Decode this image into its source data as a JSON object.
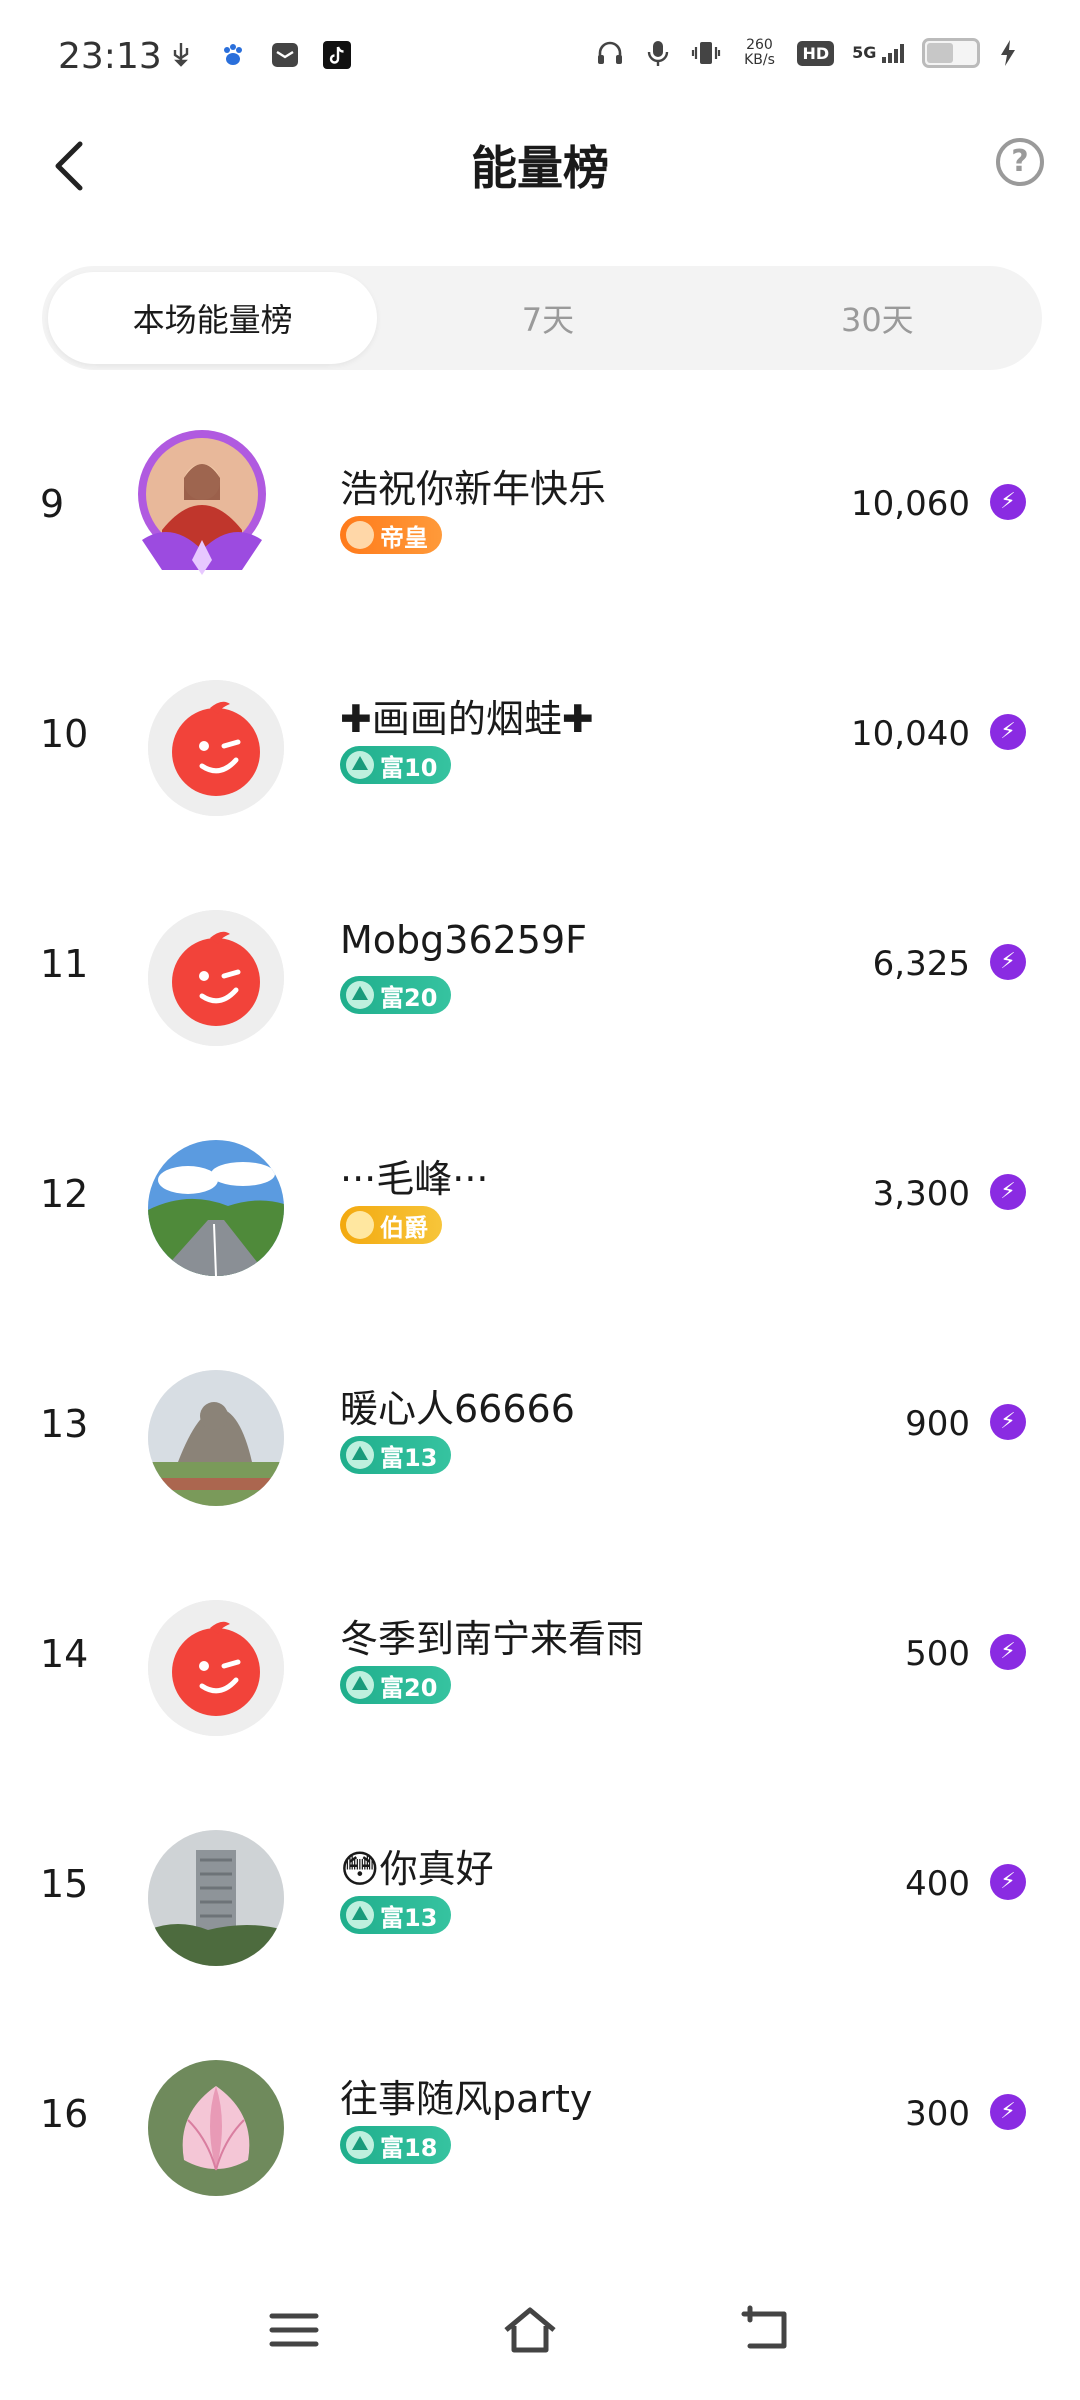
{
  "status_bar": {
    "time": "23:13",
    "net_speed_value": "260",
    "net_speed_unit": "KB/s",
    "hd_label": "HD",
    "signal_label": "5G"
  },
  "header": {
    "title": "能量榜"
  },
  "tabs": [
    {
      "label": "本场能量榜",
      "active": true
    },
    {
      "label": "7天",
      "active": false
    },
    {
      "label": "30天",
      "active": false
    }
  ],
  "rows": [
    {
      "rank": "9",
      "name": "浩祝你新年快乐",
      "badge": "帝皇",
      "badge_style": "orange",
      "score": "10,060",
      "avatar": "photo-framed"
    },
    {
      "rank": "10",
      "name": "✚画画的烟蛙✚",
      "badge": "富10",
      "badge_style": "green",
      "score": "10,040",
      "avatar": "default"
    },
    {
      "rank": "11",
      "name": "Mobg36259F",
      "badge": "富20",
      "badge_style": "green",
      "score": "6,325",
      "avatar": "default"
    },
    {
      "rank": "12",
      "name": "···毛峰···",
      "badge": "伯爵",
      "badge_style": "gold",
      "score": "3,300",
      "avatar": "landscape"
    },
    {
      "rank": "13",
      "name": "暖心人66666",
      "badge": "富13",
      "badge_style": "green",
      "score": "900",
      "avatar": "statue"
    },
    {
      "rank": "14",
      "name": "冬季到南宁来看雨",
      "badge": "富20",
      "badge_style": "green",
      "score": "500",
      "avatar": "default"
    },
    {
      "rank": "15",
      "name": "😳你真好",
      "badge": "富13",
      "badge_style": "green",
      "score": "400",
      "avatar": "building"
    },
    {
      "rank": "16",
      "name": "往事随风party",
      "badge": "富18",
      "badge_style": "green",
      "score": "300",
      "avatar": "lotus"
    }
  ],
  "colors": {
    "accent_purple": "#8a2be2",
    "badge_green": "#1fae8c",
    "badge_orange": "#ff7a1a",
    "badge_gold": "#f3a90f",
    "default_avatar_red": "#f2433a"
  }
}
